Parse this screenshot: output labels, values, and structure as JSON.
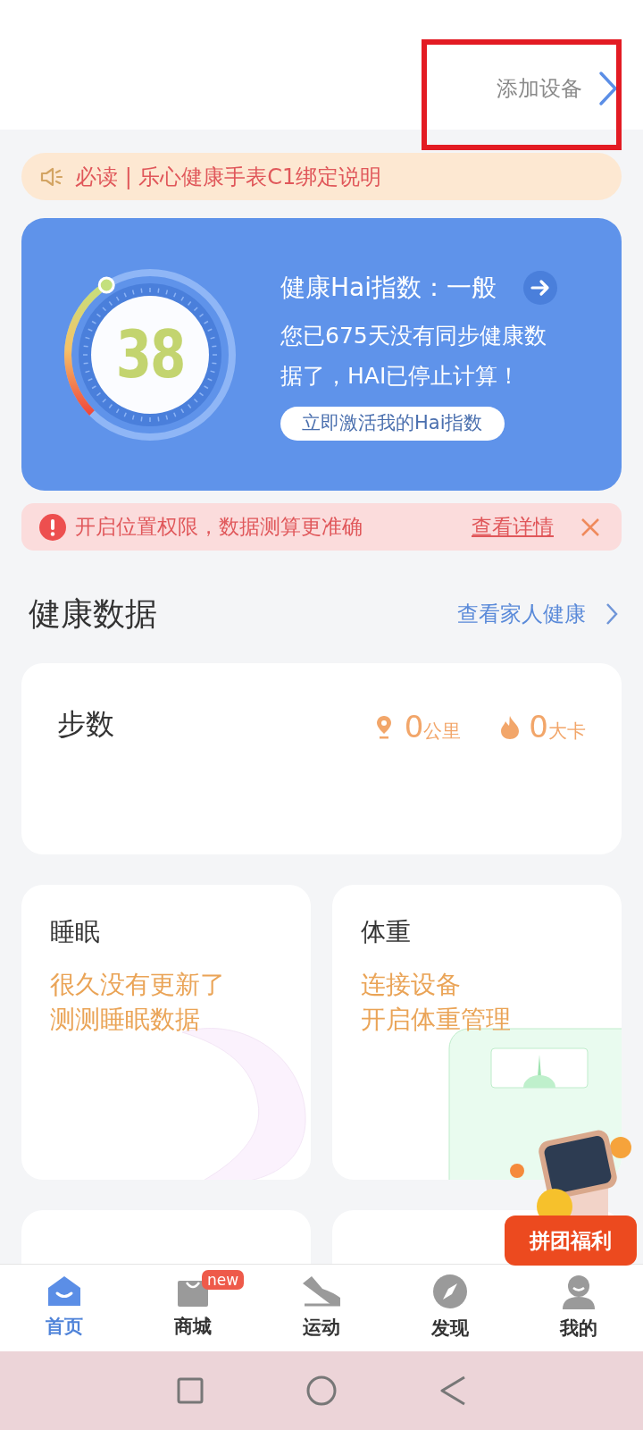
{
  "header": {
    "add_device": "添加设备"
  },
  "notice": {
    "text": "必读 | 乐心健康手表C1绑定说明"
  },
  "hai_card": {
    "score": "38",
    "title": "健康Hai指数：一般",
    "message": "您已675天没有同步健康数据了，HAI已停止计算！",
    "button": "立即激活我的Hai指数"
  },
  "alert": {
    "text": "开启位置权限，数据测算更准确",
    "link": "查看详情"
  },
  "section": {
    "title": "健康数据",
    "link": "查看家人健康"
  },
  "steps": {
    "title": "步数",
    "distance": "0",
    "distance_unit": "公里",
    "calories": "0",
    "calories_unit": "大卡"
  },
  "cards": [
    {
      "kind": "sleep",
      "title": "睡眠",
      "lines": [
        "很久没有更新了",
        "测测睡眠数据"
      ]
    },
    {
      "kind": "weight",
      "title": "体重",
      "lines": [
        "连接设备",
        "开启体重管理"
      ]
    }
  ],
  "promo": {
    "label": "拼团福利"
  },
  "tabs": [
    {
      "kind": "home",
      "label": "首页",
      "selected": true
    },
    {
      "kind": "shop",
      "label": "商城",
      "badge": "new",
      "selected": false
    },
    {
      "kind": "sport",
      "label": "运动",
      "selected": false
    },
    {
      "kind": "discover",
      "label": "发现",
      "selected": false
    },
    {
      "kind": "me",
      "label": "我的",
      "selected": false
    }
  ]
}
